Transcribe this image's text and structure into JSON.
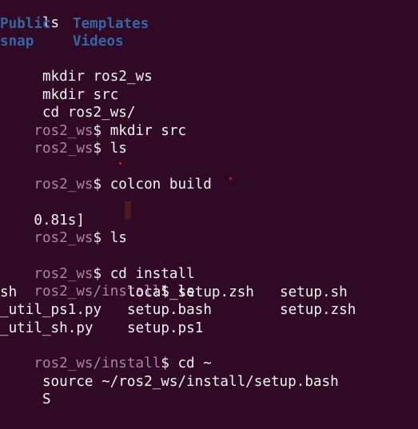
{
  "colors": {
    "background": "#300a24",
    "prompt_path": "#ad7fa8",
    "directory": "#3465a4",
    "text": "#f2f2f2"
  },
  "lines": {
    "l1": {
      "text": " ls"
    },
    "l2": {
      "col1": "Public",
      "col2": "Templates"
    },
    "l3": {
      "col1": "snap",
      "col2": "Videos"
    },
    "l4": {
      "text": " mkdir ros2_ws"
    },
    "l5": {
      "text": " mkdir src"
    },
    "l6": {
      "text": " cd ros2_ws/"
    },
    "l7": {
      "path": "ros2_ws",
      "sym": "$",
      "cmd": " mkdir src"
    },
    "l8": {
      "path": "ros2_ws",
      "sym": "$",
      "cmd": " ls"
    },
    "l9": {
      "path": "ros2_ws",
      "sym": "$",
      "cmd": " colcon build"
    },
    "l10": {
      "text": "0.81s]"
    },
    "l11": {
      "path": "ros2_ws",
      "sym": "$",
      "cmd": " ls"
    },
    "l12": {
      "path": "ros2_ws",
      "sym": "$",
      "cmd": " cd install"
    },
    "l13": {
      "path": "ros2_ws/install",
      "sym": "$",
      "cmd": " ls"
    },
    "l14": {
      "col1": "sh",
      "col2": "local_setup.zsh",
      "col3": "setup.sh"
    },
    "l15": {
      "col1": "_util_ps1.py",
      "col2": "setup.bash",
      "col3": "setup.zsh"
    },
    "l16": {
      "col1": "_util_sh.py",
      "col2": "setup.ps1"
    },
    "l17": {
      "path": "ros2_ws/install",
      "sym": "$",
      "cmd": " cd ~"
    },
    "l18": {
      "text": " source ~/ros2_ws/install/setup.bash"
    },
    "l19": {
      "text": " S"
    }
  }
}
